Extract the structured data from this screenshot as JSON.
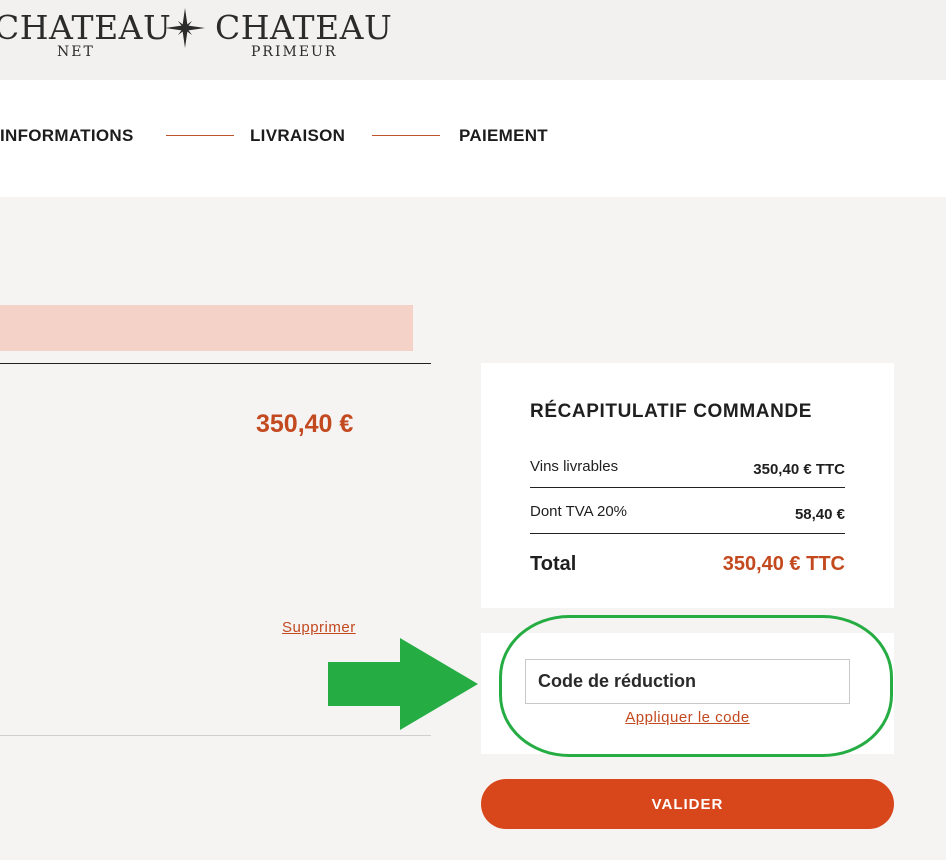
{
  "header": {
    "logo": {
      "left_word": "CHATEAU",
      "left_sub": "NET",
      "right_word": "CHATEAU",
      "right_sub": "PRIMEUR",
      "icon": "compass-star-icon"
    }
  },
  "steps": [
    {
      "label": "INFORMATIONS"
    },
    {
      "label": "LIVRAISON"
    },
    {
      "label": "PAIEMENT"
    }
  ],
  "cart": {
    "item_price": "350,40 €",
    "delete_label": "Supprimer"
  },
  "summary": {
    "title": "RÉCAPITULATIF COMMANDE",
    "rows": [
      {
        "label": "Vins livrables",
        "value": "350,40 € TTC"
      },
      {
        "label": "Dont TVA 20%",
        "value": "58,40 €"
      }
    ],
    "total": {
      "label": "Total",
      "value": "350,40 € TTC"
    }
  },
  "promo": {
    "placeholder": "Code de réduction",
    "apply_label": "Appliquer le code"
  },
  "actions": {
    "validate_label": "VALIDER"
  },
  "colors": {
    "accent": "#c3491f",
    "button": "#d8461b",
    "highlight": "#25ad43",
    "pink_banner": "#f5d2c8"
  },
  "annotation": {
    "arrow_icon": "green-arrow-right-icon",
    "highlight_shape": "green-ellipse-outline"
  }
}
